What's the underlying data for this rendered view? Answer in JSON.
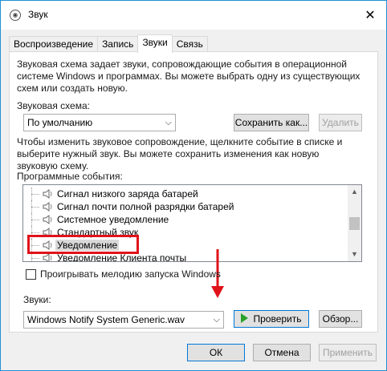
{
  "window": {
    "title": "Звук"
  },
  "tabs": [
    {
      "label": "Воспроизведение"
    },
    {
      "label": "Запись"
    },
    {
      "label": "Звуки"
    },
    {
      "label": "Связь"
    }
  ],
  "sounds_tab": {
    "description": "Звуковая схема задает звуки, сопровождающие события в операционной системе Windows и программах. Вы можете выбрать одну из существующих схем или создать новую.",
    "scheme_label": "Звуковая схема:",
    "scheme_value": "По умолчанию",
    "save_as_label": "Сохранить как...",
    "delete_label": "Удалить",
    "instructions": "Чтобы изменить звуковое сопровождение, щелкните событие в списке и выберите нужный звук. Вы можете сохранить изменения как новую звуковую схему.",
    "events_label": "Программные события:",
    "events": [
      {
        "label": "Сигнал низкого заряда батарей"
      },
      {
        "label": "Сигнал почти полной разрядки батарей"
      },
      {
        "label": "Системное уведомление"
      },
      {
        "label": "Стандартный звук"
      },
      {
        "label": "Уведомление"
      },
      {
        "label": "Уведомление Клиента почты"
      }
    ],
    "selected_event": "Уведомление",
    "startup_checkbox_label": "Проигрывать мелодию запуска Windows",
    "startup_checked": false,
    "sounds_label": "Звуки:",
    "sound_file": "Windows Notify System Generic.wav",
    "test_label": "Проверить",
    "browse_label": "Обзор..."
  },
  "footer": {
    "ok_label": "ОК",
    "cancel_label": "Отмена",
    "apply_label": "Применить"
  },
  "colors": {
    "accent": "#0078d7",
    "highlight_box": "#e0131a",
    "play": "#2aa12a"
  }
}
